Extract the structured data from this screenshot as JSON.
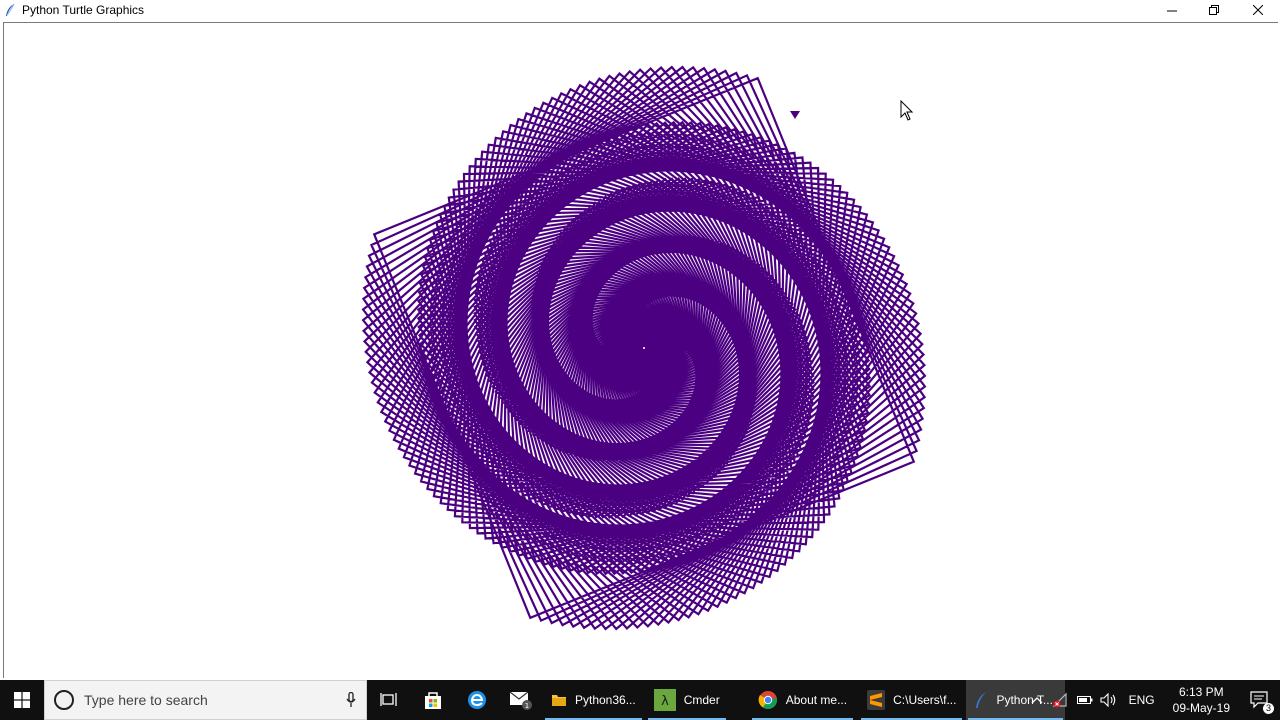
{
  "window": {
    "title": "Python Turtle Graphics"
  },
  "drawing": {
    "pen_color": "#4b0082",
    "background": "#ffffff"
  },
  "taskbar": {
    "search_placeholder": "Type here to search",
    "apps": [
      {
        "label": "Python36...",
        "icon": "folder-icon"
      },
      {
        "label": "Cmder",
        "icon": "cmder-icon"
      },
      {
        "label": "About me...",
        "icon": "chrome-icon"
      },
      {
        "label": "C:\\Users\\f...",
        "icon": "sublime-icon"
      },
      {
        "label": "Python T...",
        "icon": "python-turtle-icon"
      }
    ],
    "tray": {
      "language": "ENG",
      "time": "6:13 PM",
      "date": "09-May-19",
      "notification_count": "3"
    }
  }
}
